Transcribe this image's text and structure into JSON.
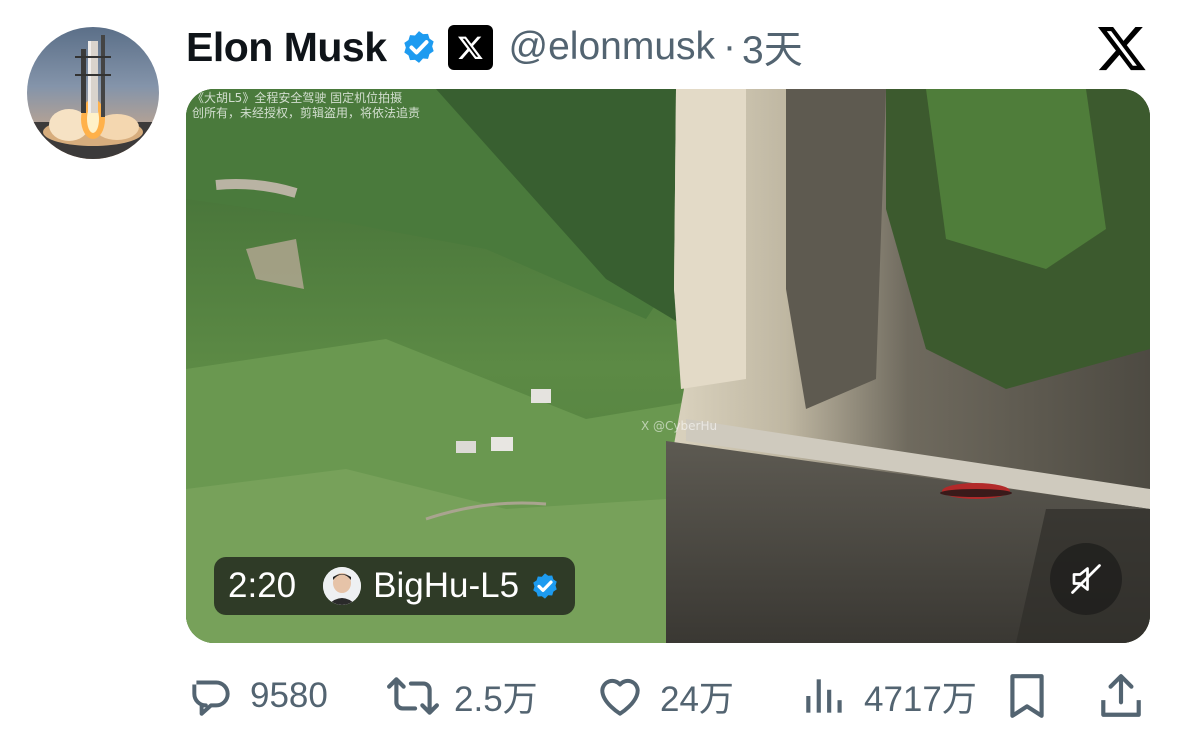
{
  "tweet": {
    "author_name": "Elon Musk",
    "handle": "@elonmusk",
    "separator": "·",
    "time": "3天"
  },
  "media": {
    "watermark_top_line1": "《大胡L5》全程安全驾驶 固定机位拍摄",
    "watermark_top_line2": "创所有，未经授权，剪辑盗用，将依法追责",
    "watermark_mid": "X @CyberHu",
    "duration": "2:20",
    "source_name": "BigHu-L5"
  },
  "actions": {
    "replies": "9580",
    "reposts": "2.5万",
    "likes": "24万",
    "views": "4717万"
  },
  "colors": {
    "verified_blue": "#1d9bf0",
    "text_primary": "#0f1419",
    "text_secondary": "#536471"
  },
  "icons": {
    "verified": "verified-badge-icon",
    "x_affiliate": "x-affiliate-badge-icon",
    "x_logo": "x-logo-icon",
    "mute": "muted-speaker-icon",
    "reply": "reply-icon",
    "repost": "repost-icon",
    "like": "heart-icon",
    "views": "views-chart-icon",
    "bookmark": "bookmark-icon",
    "share": "share-icon"
  }
}
